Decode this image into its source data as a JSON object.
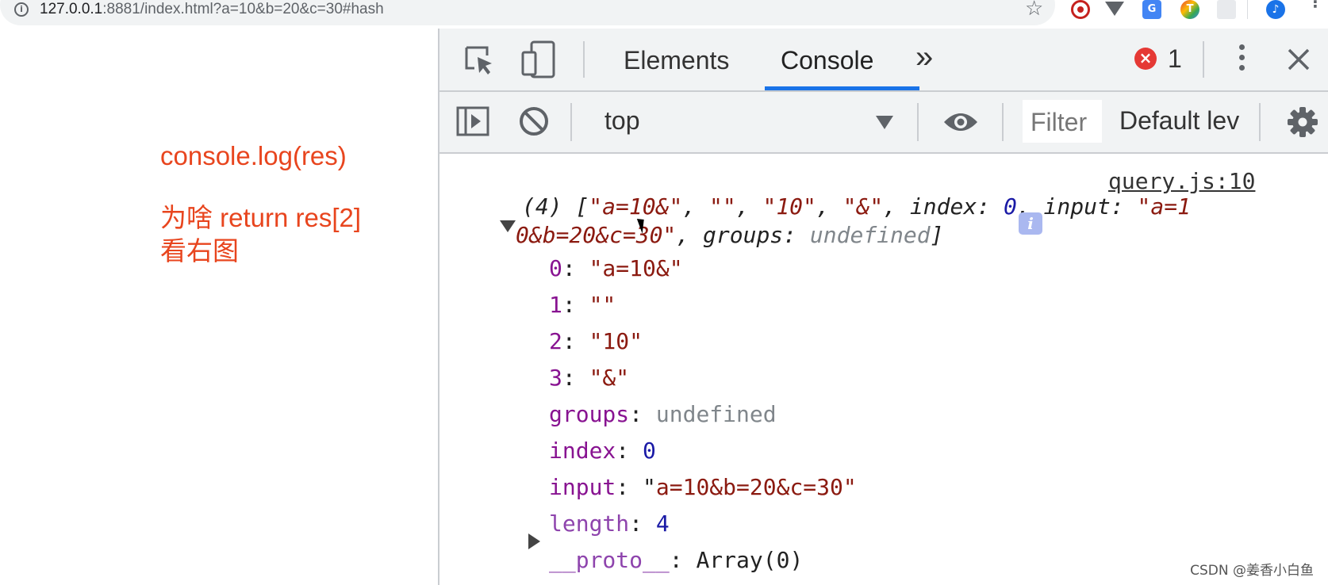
{
  "browser": {
    "url_host": "127.0.0.1",
    "url_rest": ":8881/index.html?a=10&b=20&c=30#hash",
    "extensions": [
      "red-circle-extension-icon",
      "vue-devtools-extension-icon",
      "google-translate-extension-icon",
      "colorful-t-extension-icon",
      "react-extension-icon",
      "music-extension-icon"
    ]
  },
  "page": {
    "note_line1": "console.log(res)",
    "note_line2": "为啥 return res[2]",
    "note_line3": "看右图"
  },
  "devtools": {
    "tabs": [
      "Elements",
      "Console"
    ],
    "active_tab": "Console",
    "more_tabs": "»",
    "error_count": "1",
    "context": "top",
    "filter_placeholder": "Filter",
    "levels": "Default lev",
    "accent": "#1a73e8"
  },
  "console": {
    "source": "query.js:10",
    "summary_1_count": "(4) [",
    "summary_1_items": "\"a=10&\"",
    "summary_1_sep1": ", ",
    "summary_1_empty": "\"\"",
    "summary_1_sep2": ", ",
    "summary_1_ten": "\"10\"",
    "summary_1_sep3": ", ",
    "summary_1_amp": "\"&\"",
    "summary_1_sep4": ", ",
    "summary_1_index_key": "index",
    "summary_1_colon": ": ",
    "summary_1_index_val": "0",
    "summary_1_sep5": ", ",
    "summary_1_input_key": "input",
    "summary_1_colon2": ": ",
    "summary_1_input_val_a": "\"a=1",
    "summary_2_input_val_b": "0&b=20&c=30\"",
    "summary_2_sep": ", ",
    "summary_2_groups_key": "groups",
    "summary_2_colon": ": ",
    "summary_2_groups_val": "undefined",
    "summary_2_end": "]",
    "rows": [
      {
        "key": "0",
        "value": "\"a=10&\""
      },
      {
        "key": "1",
        "value": "\"\""
      },
      {
        "key": "2",
        "value": "\"10\""
      },
      {
        "key": "3",
        "value": "\"&\""
      },
      {
        "key": "groups",
        "value": "undefined"
      },
      {
        "key": "index",
        "value": "0"
      },
      {
        "key": "input",
        "value": "\"a=10&b=20&c=30\""
      },
      {
        "key": "length",
        "value": "4"
      },
      {
        "key": "__proto__",
        "value": "Array(0)"
      }
    ]
  },
  "watermark": "CSDN @姜香小白鱼"
}
